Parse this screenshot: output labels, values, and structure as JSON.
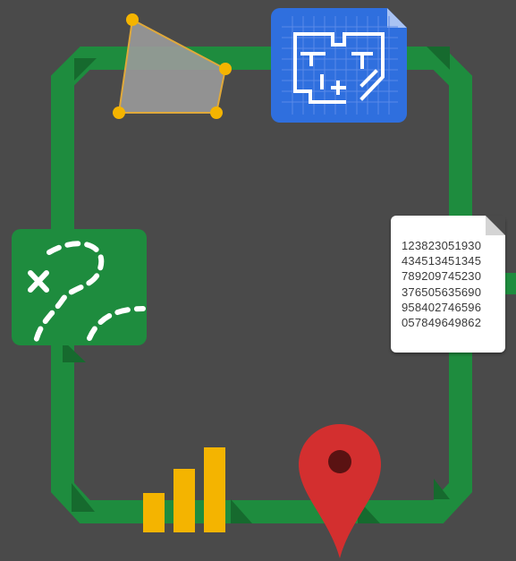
{
  "colors": {
    "background": "#4a4a4a",
    "track": "#1e8c3e",
    "track_shadow": "#166a2e",
    "polygon_fill": "#9a9a9a",
    "polygon_vertex": "#f4b400",
    "blueprint": "#2f6fde",
    "map_tile": "#1e8c3e",
    "bars": "#f4b400",
    "pin": "#d32f2f",
    "pin_center": "#5a1212"
  },
  "icons": {
    "polygon": "polygon-shape-icon",
    "blueprint": "floor-plan-document-icon",
    "map": "treasure-map-icon",
    "numbers": "data-table-document-icon",
    "bars": "bar-chart-icon",
    "pin": "map-pin-icon"
  },
  "numbers_doc": {
    "rows": [
      "123823051930",
      "434513451345",
      "789209745230",
      "376505635690",
      "958402746596",
      "057849649862"
    ]
  }
}
